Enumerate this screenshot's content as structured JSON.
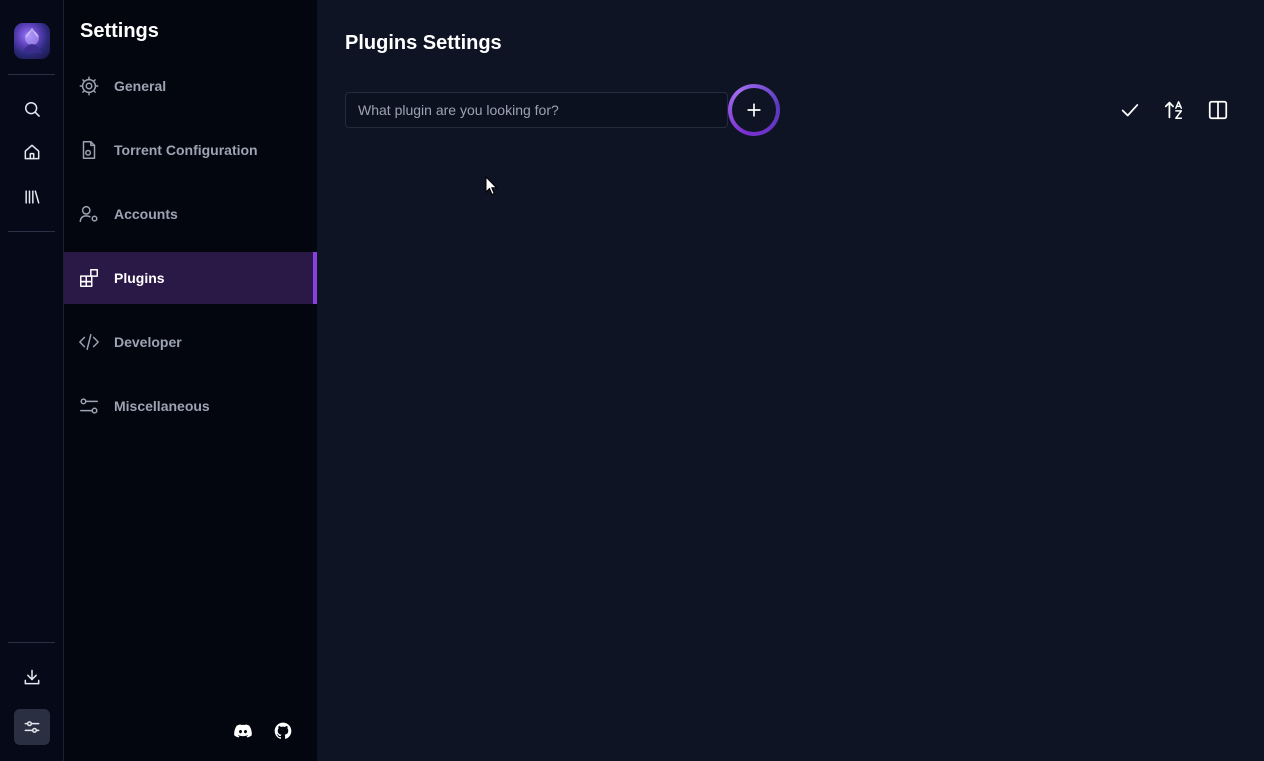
{
  "sidebar": {
    "title": "Settings",
    "items": [
      {
        "label": "General",
        "icon": "gear-icon"
      },
      {
        "label": "Torrent Configuration",
        "icon": "file-settings-icon"
      },
      {
        "label": "Accounts",
        "icon": "user-settings-icon"
      },
      {
        "label": "Plugins",
        "icon": "plugins-icon",
        "active": true
      },
      {
        "label": "Developer",
        "icon": "code-icon"
      },
      {
        "label": "Miscellaneous",
        "icon": "sliders-icon"
      }
    ]
  },
  "rail": {
    "items": [
      "search-icon",
      "home-icon",
      "library-icon",
      "download-icon",
      "settings-sliders-icon"
    ]
  },
  "main": {
    "title": "Plugins Settings",
    "search": {
      "placeholder": "What plugin are you looking for?",
      "value": ""
    }
  },
  "colors": {
    "accent": "#8a3fe0",
    "active_bg": "#2a1846",
    "background": "#0f1424",
    "sidebar_bg": "#03060f"
  }
}
